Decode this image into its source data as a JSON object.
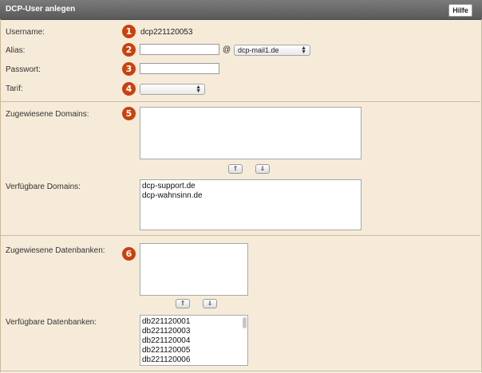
{
  "header": {
    "title": "DCP-User anlegen",
    "help_label": "Hilfe"
  },
  "badges": [
    "1",
    "2",
    "3",
    "4",
    "5",
    "6"
  ],
  "form": {
    "username": {
      "label": "Username:",
      "value": "dcp221120053"
    },
    "alias": {
      "label": "Alias:",
      "value": "",
      "at": "@",
      "domain_selected": "dcp-mail1.de"
    },
    "passwort": {
      "label": "Passwort:",
      "value": ""
    },
    "tarif": {
      "label": "Tarif:",
      "selected": ""
    }
  },
  "domains": {
    "assigned_label": "Zugewiesene Domains:",
    "assigned": [],
    "available_label": "Verfügbare Domains:",
    "available": [
      "dcp-support.de",
      "dcp-wahnsinn.de"
    ],
    "up_icon": "arrow-up-icon",
    "down_icon": "arrow-down-icon"
  },
  "databases": {
    "assigned_label": "Zugewiesene Datenbanken:",
    "assigned": [],
    "available_label": "Verfügbare Datenbanken:",
    "available": [
      "db221120001",
      "db221120003",
      "db221120004",
      "db221120005",
      "db221120006"
    ]
  }
}
